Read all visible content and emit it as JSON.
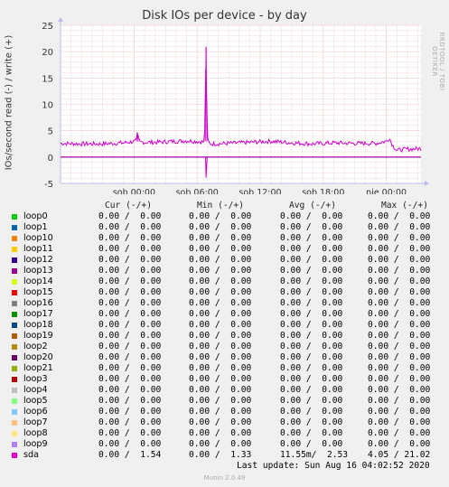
{
  "chart_data": {
    "type": "line",
    "title": "Disk IOs per device - by day",
    "ylabel": "IOs/second read (-) / write (+)",
    "side_label": "RRDTOOL / TOBI OETIKER",
    "ylim": [
      -5,
      25
    ],
    "yticks": [
      -5,
      0,
      5,
      10,
      15,
      20,
      25
    ],
    "xlim_hours": [
      -7,
      27.3
    ],
    "xticks": [
      {
        "label": "sob 00:00",
        "hour": 0
      },
      {
        "label": "sob 06:00",
        "hour": 6
      },
      {
        "label": "sob 12:00",
        "hour": 12
      },
      {
        "label": "sob 18:00",
        "hour": 18
      },
      {
        "label": "nie 00:00",
        "hour": 24
      }
    ],
    "grid": true,
    "series": [
      {
        "name": "sda",
        "color": "#CC00CC",
        "write": [
          [
            -7,
            2.6
          ],
          [
            -5,
            2.5
          ],
          [
            -3,
            2.5
          ],
          [
            -1,
            2.7
          ],
          [
            0.2,
            3.0
          ],
          [
            0.3,
            4.7
          ],
          [
            0.5,
            2.8
          ],
          [
            2,
            2.8
          ],
          [
            4,
            3.0
          ],
          [
            5,
            3.1
          ],
          [
            6.5,
            2.9
          ],
          [
            6.7,
            2.6
          ],
          [
            6.85,
            20.9
          ],
          [
            6.95,
            3.5
          ],
          [
            7.2,
            2.5
          ],
          [
            9,
            2.6
          ],
          [
            11,
            2.8
          ],
          [
            13,
            3.0
          ],
          [
            15,
            2.7
          ],
          [
            17,
            2.5
          ],
          [
            19,
            2.7
          ],
          [
            21,
            2.6
          ],
          [
            23,
            2.6
          ],
          [
            24,
            3.0
          ],
          [
            24.3,
            3.6
          ],
          [
            24.6,
            2.2
          ],
          [
            25,
            1.3
          ],
          [
            26,
            1.5
          ],
          [
            27.3,
            1.6
          ]
        ],
        "read": [
          [
            -7,
            0
          ],
          [
            6.8,
            0
          ],
          [
            6.85,
            -3.9
          ],
          [
            6.95,
            0
          ],
          [
            27.3,
            0
          ]
        ]
      }
    ]
  },
  "legend": {
    "headers": {
      "cur": "Cur (-/+)",
      "min": "Min (-/+)",
      "avg": "Avg (-/+)",
      "max": "Max (-/+)"
    },
    "rows": [
      {
        "name": "loop0",
        "color": "#00CC00",
        "cur": "0.00 /  0.00",
        "min": "0.00 /  0.00",
        "avg": "0.00 /  0.00",
        "max": "0.00 /  0.00"
      },
      {
        "name": "loop1",
        "color": "#0066B3",
        "cur": "0.00 /  0.00",
        "min": "0.00 /  0.00",
        "avg": "0.00 /  0.00",
        "max": "0.00 /  0.00"
      },
      {
        "name": "loop10",
        "color": "#FF8000",
        "cur": "0.00 /  0.00",
        "min": "0.00 /  0.00",
        "avg": "0.00 /  0.00",
        "max": "0.00 /  0.00"
      },
      {
        "name": "loop11",
        "color": "#FFCC00",
        "cur": "0.00 /  0.00",
        "min": "0.00 /  0.00",
        "avg": "0.00 /  0.00",
        "max": "0.00 /  0.00"
      },
      {
        "name": "loop12",
        "color": "#330099",
        "cur": "0.00 /  0.00",
        "min": "0.00 /  0.00",
        "avg": "0.00 /  0.00",
        "max": "0.00 /  0.00"
      },
      {
        "name": "loop13",
        "color": "#990099",
        "cur": "0.00 /  0.00",
        "min": "0.00 /  0.00",
        "avg": "0.00 /  0.00",
        "max": "0.00 /  0.00"
      },
      {
        "name": "loop14",
        "color": "#CCFF00",
        "cur": "0.00 /  0.00",
        "min": "0.00 /  0.00",
        "avg": "0.00 /  0.00",
        "max": "0.00 /  0.00"
      },
      {
        "name": "loop15",
        "color": "#FF0000",
        "cur": "0.00 /  0.00",
        "min": "0.00 /  0.00",
        "avg": "0.00 /  0.00",
        "max": "0.00 /  0.00"
      },
      {
        "name": "loop16",
        "color": "#808080",
        "cur": "0.00 /  0.00",
        "min": "0.00 /  0.00",
        "avg": "0.00 /  0.00",
        "max": "0.00 /  0.00"
      },
      {
        "name": "loop17",
        "color": "#008F00",
        "cur": "0.00 /  0.00",
        "min": "0.00 /  0.00",
        "avg": "0.00 /  0.00",
        "max": "0.00 /  0.00"
      },
      {
        "name": "loop18",
        "color": "#00487D",
        "cur": "0.00 /  0.00",
        "min": "0.00 /  0.00",
        "avg": "0.00 /  0.00",
        "max": "0.00 /  0.00"
      },
      {
        "name": "loop19",
        "color": "#B35A00",
        "cur": "0.00 /  0.00",
        "min": "0.00 /  0.00",
        "avg": "0.00 /  0.00",
        "max": "0.00 /  0.00"
      },
      {
        "name": "loop2",
        "color": "#B38F00",
        "cur": "0.00 /  0.00",
        "min": "0.00 /  0.00",
        "avg": "0.00 /  0.00",
        "max": "0.00 /  0.00"
      },
      {
        "name": "loop20",
        "color": "#6B006B",
        "cur": "0.00 /  0.00",
        "min": "0.00 /  0.00",
        "avg": "0.00 /  0.00",
        "max": "0.00 /  0.00"
      },
      {
        "name": "loop21",
        "color": "#8FB300",
        "cur": "0.00 /  0.00",
        "min": "0.00 /  0.00",
        "avg": "0.00 /  0.00",
        "max": "0.00 /  0.00"
      },
      {
        "name": "loop3",
        "color": "#B30000",
        "cur": "0.00 /  0.00",
        "min": "0.00 /  0.00",
        "avg": "0.00 /  0.00",
        "max": "0.00 /  0.00"
      },
      {
        "name": "loop4",
        "color": "#BEBEBE",
        "cur": "0.00 /  0.00",
        "min": "0.00 /  0.00",
        "avg": "0.00 /  0.00",
        "max": "0.00 /  0.00"
      },
      {
        "name": "loop5",
        "color": "#80FF80",
        "cur": "0.00 /  0.00",
        "min": "0.00 /  0.00",
        "avg": "0.00 /  0.00",
        "max": "0.00 /  0.00"
      },
      {
        "name": "loop6",
        "color": "#80C9FF",
        "cur": "0.00 /  0.00",
        "min": "0.00 /  0.00",
        "avg": "0.00 /  0.00",
        "max": "0.00 /  0.00"
      },
      {
        "name": "loop7",
        "color": "#FFC080",
        "cur": "0.00 /  0.00",
        "min": "0.00 /  0.00",
        "avg": "0.00 /  0.00",
        "max": "0.00 /  0.00"
      },
      {
        "name": "loop8",
        "color": "#FFE680",
        "cur": "0.00 /  0.00",
        "min": "0.00 /  0.00",
        "avg": "0.00 /  0.00",
        "max": "0.00 /  0.00"
      },
      {
        "name": "loop9",
        "color": "#AA80FF",
        "cur": "0.00 /  0.00",
        "min": "0.00 /  0.00",
        "avg": "0.00 /  0.00",
        "max": "0.00 /  0.00"
      },
      {
        "name": "sda",
        "color": "#EE00CC",
        "cur": "0.00 /  1.54",
        "min": "0.00 /  1.33",
        "avg": "11.55m/  2.53",
        "max": "4.05 / 21.02"
      }
    ]
  },
  "footer": {
    "last_update": "Last update: Sun Aug 16 04:02:52 2020",
    "generator": "Munin 2.0.49"
  }
}
